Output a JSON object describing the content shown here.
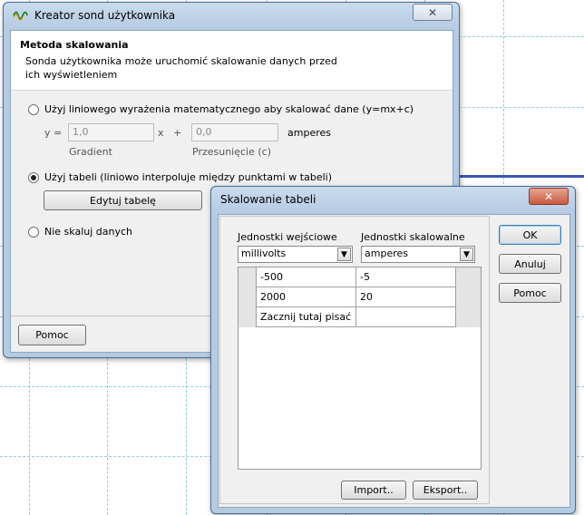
{
  "main_dialog": {
    "title": "Kreator sond użytkownika",
    "header_title": "Metoda skalowania",
    "header_desc": "Sonda użytkownika może uruchomić skalowanie danych przed ich wyświetleniem",
    "option_linear": "Użyj liniowego wyrażenia matematycznego aby skalować dane (y=mx+c)",
    "eq_y": "y =",
    "gradient_value": "1,0",
    "eq_x": "x",
    "eq_plus": "+",
    "offset_value": "0,0",
    "unit": "amperes",
    "gradient_label": "Gradient",
    "offset_label": "Przesunięcie (c)",
    "option_table": "Użyj tabeli (liniowo interpoluje między punktami w tabeli)",
    "edit_table_button": "Edytuj tabelę",
    "option_none": "Nie skaluj danych",
    "help_button": "Pomoc",
    "selected_option": "table"
  },
  "table_dialog": {
    "title": "Skalowanie tabeli",
    "input_units_label": "Jednostki wejściowe",
    "input_units_value": "millivolts",
    "scaled_units_label": "Jednostki skalowalne",
    "scaled_units_value": "amperes",
    "rows": [
      {
        "input": "-500",
        "scaled": "-5"
      },
      {
        "input": "2000",
        "scaled": "20"
      },
      {
        "input": "Zacznij tutaj pisać",
        "scaled": ""
      }
    ],
    "ok_button": "OK",
    "cancel_button": "Anuluj",
    "help_button": "Pomoc",
    "import_button": "Import..",
    "export_button": "Eksport.."
  },
  "colors": {
    "trace": "#3c55b8",
    "grid": "#8fd0de",
    "title_bar": "#b5cbe3",
    "close_red": "#c75a40"
  }
}
